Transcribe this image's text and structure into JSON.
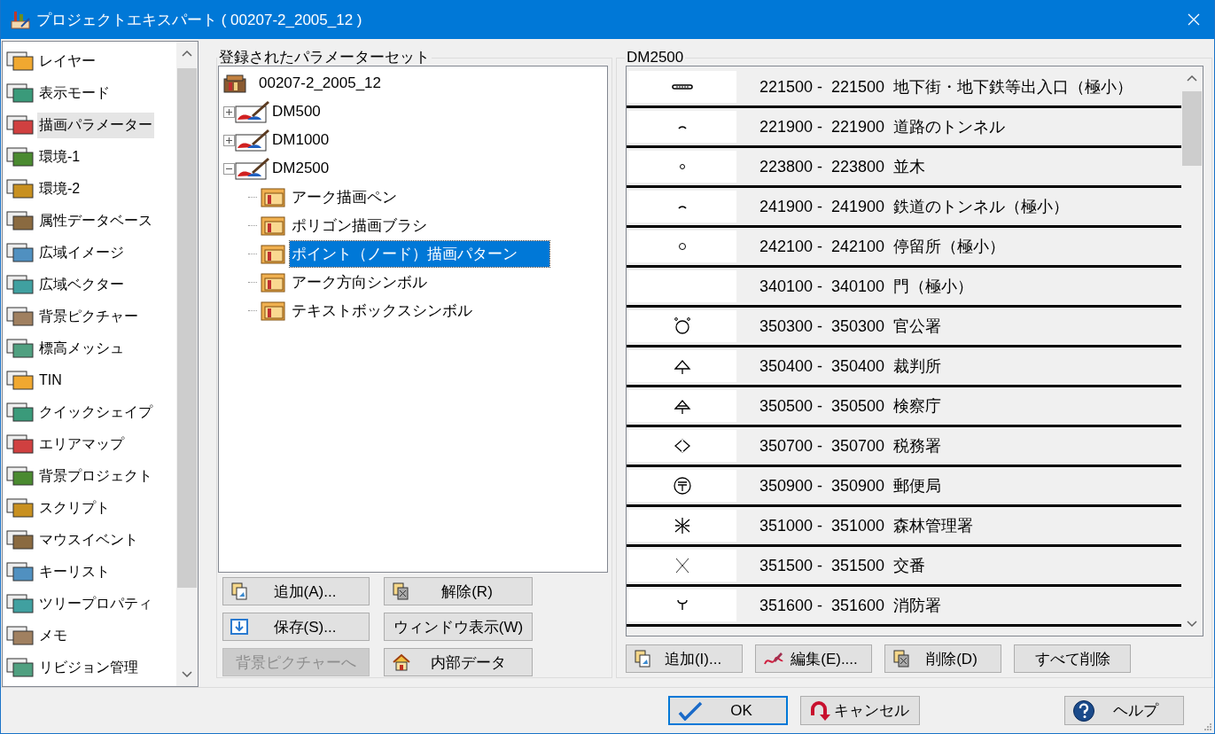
{
  "window": {
    "title": "プロジェクトエキスパート ( 00207-2_2005_12 )"
  },
  "sidebar": {
    "items": [
      {
        "label": "レイヤー",
        "selected": false
      },
      {
        "label": "表示モード",
        "selected": false
      },
      {
        "label": "描画パラメーター",
        "selected": true
      },
      {
        "label": "環境-1",
        "selected": false
      },
      {
        "label": "環境-2",
        "selected": false
      },
      {
        "label": "属性データベース",
        "selected": false
      },
      {
        "label": "広域イメージ",
        "selected": false
      },
      {
        "label": "広域ベクター",
        "selected": false
      },
      {
        "label": "背景ピクチャー",
        "selected": false
      },
      {
        "label": "標高メッシュ",
        "selected": false
      },
      {
        "label": "TIN",
        "selected": false
      },
      {
        "label": "クイックシェイプ",
        "selected": false
      },
      {
        "label": "エリアマップ",
        "selected": false
      },
      {
        "label": "背景プロジェクト",
        "selected": false
      },
      {
        "label": "スクリプト",
        "selected": false
      },
      {
        "label": "マウスイベント",
        "selected": false
      },
      {
        "label": "キーリスト",
        "selected": false
      },
      {
        "label": "ツリープロパティ",
        "selected": false
      },
      {
        "label": "メモ",
        "selected": false
      },
      {
        "label": "リビジョン管理",
        "selected": false
      }
    ]
  },
  "parameter_sets": {
    "title": "登録されたパラメーターセット",
    "tree": {
      "label": "00207-2_2005_12",
      "children": [
        {
          "label": "DM500",
          "expanded": false
        },
        {
          "label": "DM1000",
          "expanded": false
        },
        {
          "label": "DM2500",
          "expanded": true,
          "children": [
            {
              "label": "アーク描画ペン",
              "selected": false
            },
            {
              "label": "ポリゴン描画ブラシ",
              "selected": false
            },
            {
              "label": "ポイント（ノード）描画パターン",
              "selected": true
            },
            {
              "label": "アーク方向シンボル",
              "selected": false
            },
            {
              "label": "テキストボックスシンボル",
              "selected": false
            }
          ]
        }
      ]
    },
    "buttons": [
      {
        "label": "追加(A)...",
        "kind": "add",
        "disabled": false
      },
      {
        "label": "解除(R)",
        "kind": "remove",
        "disabled": false
      },
      {
        "label": "保存(S)...",
        "kind": "save",
        "disabled": false
      },
      {
        "label": "ウィンドウ表示(W)",
        "kind": "plain",
        "disabled": false
      },
      {
        "label": "背景ピクチャーへ",
        "kind": "plain",
        "disabled": true
      },
      {
        "label": "内部データ",
        "kind": "house",
        "disabled": false
      }
    ]
  },
  "symbols": {
    "title": "DM2500",
    "rows": [
      {
        "text": "221500 -  221500  地下街・地下鉄等出入口（極小）",
        "kind": "bar"
      },
      {
        "text": "221900 -  221900  道路のトンネル",
        "kind": "arc"
      },
      {
        "text": "223800 -  223800  並木",
        "kind": "dot"
      },
      {
        "text": "241900 -  241900  鉄道のトンネル（極小）",
        "kind": "arc"
      },
      {
        "text": "242100 -  242100  停留所（極小）",
        "kind": "circle"
      },
      {
        "text": "340100 -  340100  門（極小）",
        "kind": "none"
      },
      {
        "text": "350300 -  350300  官公署",
        "kind": "ring"
      },
      {
        "text": "350400 -  350400  裁判所",
        "kind": "peak"
      },
      {
        "text": "350500 -  350500  検察庁",
        "kind": "peakbar"
      },
      {
        "text": "350700 -  350700  税務署",
        "kind": "diamond"
      },
      {
        "text": "350900 -  350900  郵便局",
        "kind": "postal"
      },
      {
        "text": "351000 -  351000  森林管理署",
        "kind": "star"
      },
      {
        "text": "351500 -  351500  交番",
        "kind": "cross"
      },
      {
        "text": "351600 -  351600  消防署",
        "kind": "fork"
      }
    ],
    "buttons": [
      {
        "label": "追加(I)...",
        "kind": "add"
      },
      {
        "label": "編集(E)....",
        "kind": "edit"
      },
      {
        "label": "削除(D)",
        "kind": "remove"
      },
      {
        "label": "すべて削除",
        "kind": "plain"
      }
    ]
  },
  "dialog_buttons": [
    {
      "label": "OK",
      "kind": "ok",
      "default": true
    },
    {
      "label": "キャンセル",
      "kind": "cancel",
      "default": false
    },
    {
      "label": "ヘルプ",
      "kind": "help",
      "default": false
    }
  ]
}
